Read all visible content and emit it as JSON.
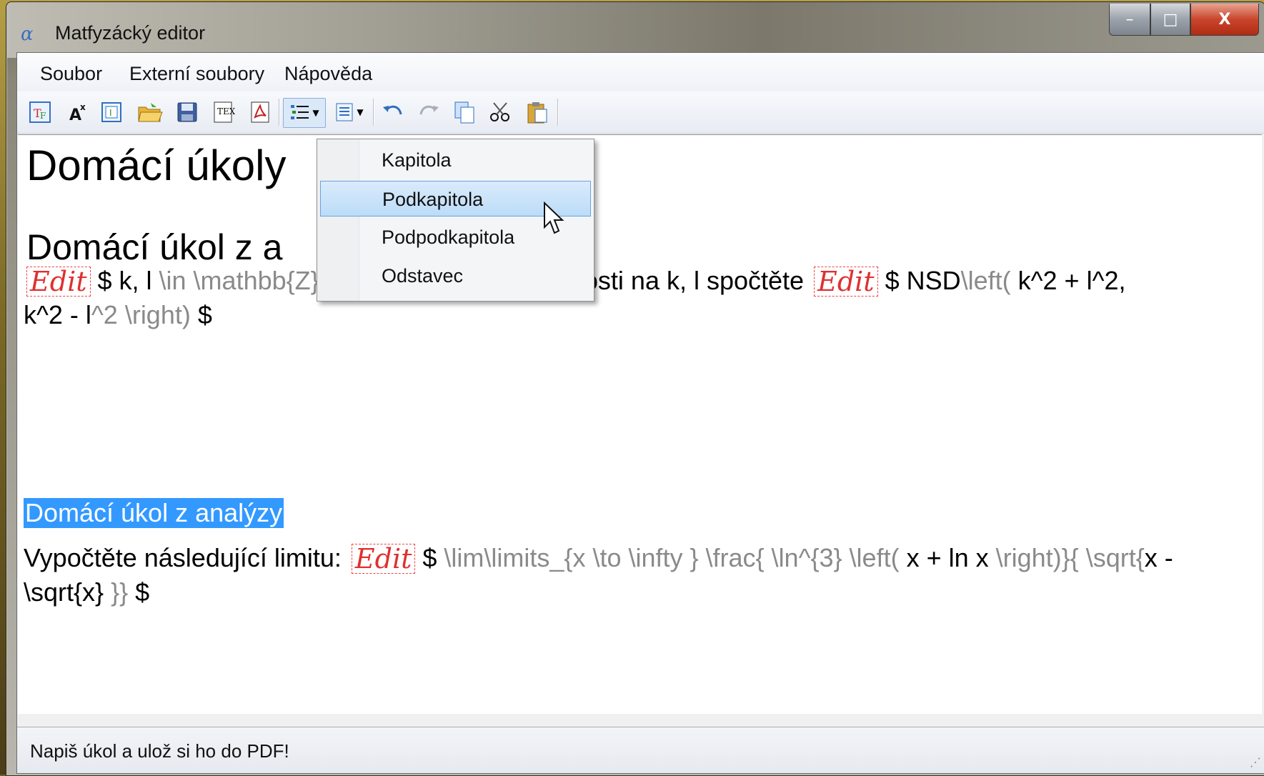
{
  "window": {
    "title": "Matfyzácký editor",
    "app_icon_glyph": "α"
  },
  "window_controls": {
    "minimize": "–",
    "maximize": "□",
    "close": "X"
  },
  "menu": {
    "items": [
      "Soubor",
      "Externí soubory",
      "Nápověda"
    ]
  },
  "toolbar": {
    "icons": [
      "new-latex-icon",
      "superscript-icon",
      "insert-icon",
      "open-folder-icon",
      "save-icon",
      "export-latex-icon",
      "pdf-icon",
      "list-structure-icon",
      "insert-block-icon",
      "undo-icon",
      "redo-icon",
      "copy-icon",
      "cut-icon",
      "paste-icon"
    ]
  },
  "dropdown": {
    "items": [
      "Kapitola",
      "Podkapitola",
      "Podpodkapitola",
      "Odstavec"
    ],
    "highlighted": "Podkapitola"
  },
  "document": {
    "heading1": "Domácí úkoly",
    "heading2": "Domácí úkol z a",
    "edit_label": "Edit",
    "p1_a1": "$ k, l ",
    "p1_a2": "\\in  \\mathbb{Z} ",
    "p1_a3": " $ nesoudělná. V závislosti na k, l spočtěte ",
    "p1_b1": "$ NSD",
    "p1_b2": "\\left( ",
    "p1_b3": "k^2 + l^2,",
    "p1_c1": "k^2 - l",
    "p1_c2": "^2 \\right) ",
    "p1_c3": "$",
    "heading3_selected": "Domácí úkol z analýzy",
    "p2_a": "Vypočtěte následující limitu: ",
    "p2_b1": "$ ",
    "p2_b2": "\\lim\\limits_{x \\to  \\infty } \\frac{ \\ln^{3} \\left( ",
    "p2_b3": "x + ln x ",
    "p2_b4": " \\right)}{ \\sqrt{",
    "p2_b5": "x -",
    "p2_c1": "\\sqrt{x}",
    "p2_c2": " }} ",
    "p2_c3": "$"
  },
  "status": {
    "text": "Napiš úkol a ulož si ho do PDF!"
  }
}
